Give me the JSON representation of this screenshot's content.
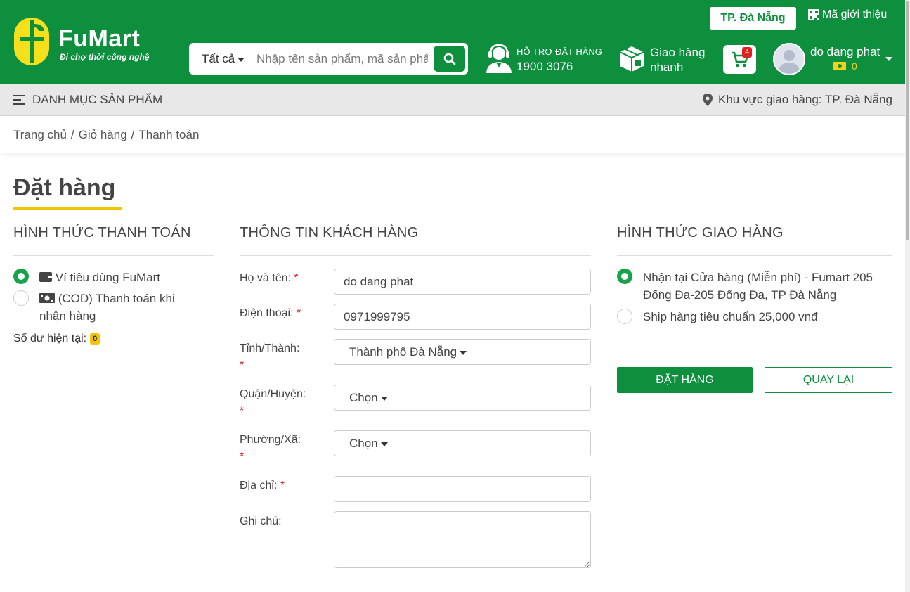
{
  "header": {
    "brand": "FuMart",
    "slogan": "Đi chợ thời công nghệ",
    "city_button": "TP. Đà Nẵng",
    "ref_code_label": "Mã giới thiệu",
    "search": {
      "category": "Tất cả",
      "placeholder": "Nhập tên sản phẩm, mã sản phẩm"
    },
    "support": {
      "label": "HỖ TRỢ ĐẶT HÀNG",
      "phone": "1900 3076"
    },
    "delivery": {
      "label": "Giao hàng nhanh"
    },
    "cart": {
      "count": "4"
    },
    "user": {
      "name": "do dang phat",
      "wallet_balance": "0"
    }
  },
  "subnav": {
    "menu_label": "DANH MỤC SẢN PHẨM",
    "area_label": "Khu vực giao hàng: TP. Đà Nẵng"
  },
  "breadcrumb": [
    "Trang chủ",
    "Giỏ hàng",
    "Thanh toán"
  ],
  "page_title": "Đặt hàng",
  "payment": {
    "heading": "HÌNH THỨC THANH TOÁN",
    "options": [
      {
        "label": "Ví tiêu dùng FuMart",
        "selected": true,
        "icon": "wallet-icon"
      },
      {
        "label": "(COD) Thanh toán khi nhận hàng",
        "selected": false,
        "icon": "cash-icon"
      }
    ],
    "balance_label": "Số dư hiện tại:",
    "balance_value": "0"
  },
  "customer": {
    "heading": "THÔNG TIN KHÁCH HÀNG",
    "fields": {
      "name": {
        "label": "Họ và tên:",
        "value": "do dang phat"
      },
      "phone": {
        "label": "Điện thoại:",
        "value": "0971999795"
      },
      "province": {
        "label": "Tỉnh/Thành:",
        "value": "Thành phố Đà Nẵng"
      },
      "district": {
        "label": "Quận/Huyện:",
        "value": "Chọn"
      },
      "ward": {
        "label": "Phường/Xã:",
        "value": "Chọn"
      },
      "address": {
        "label": "Địa chỉ:",
        "value": ""
      },
      "note": {
        "label": "Ghi chú:",
        "value": ""
      }
    },
    "required_mark": "*"
  },
  "shipping": {
    "heading": "HÌNH THỨC GIAO HÀNG",
    "options": [
      {
        "label": "Nhận tại Cửa hàng (Miễn phí) - Fumart 205 Đống Đa-205 Đống Đa, TP Đà Nẵng",
        "selected": true
      },
      {
        "label": "Ship hàng tiêu chuẩn 25,000 vnđ",
        "selected": false
      }
    ],
    "order_button": "ĐẶT HÀNG",
    "back_button": "QUAY LẠI"
  },
  "colors": {
    "brand_green": "#0d8f3e",
    "accent_yellow": "#f5c400",
    "radio_green": "#17a34a",
    "badge_red": "#e02020"
  }
}
